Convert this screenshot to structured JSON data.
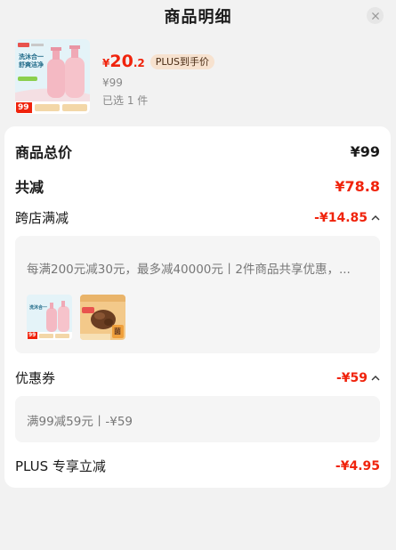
{
  "header": {
    "title": "商品明细"
  },
  "product": {
    "currency": "¥",
    "price_int": "20",
    "price_dec": ".2",
    "plus_badge": "PLUS到手价",
    "original_price": "¥99",
    "quantity": "已选 1 件",
    "thumb": {
      "slogan_1": "洗沐合一",
      "slogan_2": "舒爽洁净",
      "sticker": "99"
    }
  },
  "summary": {
    "total_label": "商品总价",
    "total_value": "¥99",
    "discount_label": "共减",
    "discount_value": "¥78.8",
    "store_label": "跨店满减",
    "store_value": "-¥14.85",
    "store_desc": "每满200元减30元，最多减40000元丨2件商品共享优惠，...",
    "coupon_label": "优惠券",
    "coupon_value": "-¥59",
    "coupon_desc": "满99减59元丨-¥59",
    "plus_label": "PLUS 专享立减",
    "plus_value": "-¥4.95"
  },
  "mini_products": [
    {
      "name": "bodywash-thumb",
      "slogan": "洗沐合一",
      "sticker": "99"
    },
    {
      "name": "mushroom-thumb",
      "label": "菌"
    }
  ],
  "colors": {
    "accent": "#f0230c",
    "badge_bg": "#f7e2cf",
    "page_bg": "#f2f2f2"
  }
}
